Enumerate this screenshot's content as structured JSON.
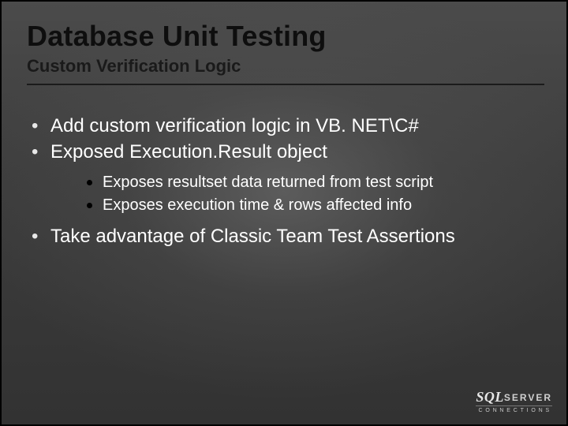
{
  "title": "Database Unit Testing",
  "subtitle": "Custom Verification Logic",
  "bullets": {
    "b1": "Add custom verification logic in VB. NET\\C#",
    "b2": "Exposed Execution.Result object",
    "b2_sub": {
      "s1": "Exposes resultset data returned from test script",
      "s2": "Exposes execution time & rows affected info"
    },
    "b3": "Take advantage of Classic Team Test Assertions"
  },
  "logo": {
    "sql": "SQL",
    "server": "SERVER",
    "sub": "CONNECTIONS"
  }
}
